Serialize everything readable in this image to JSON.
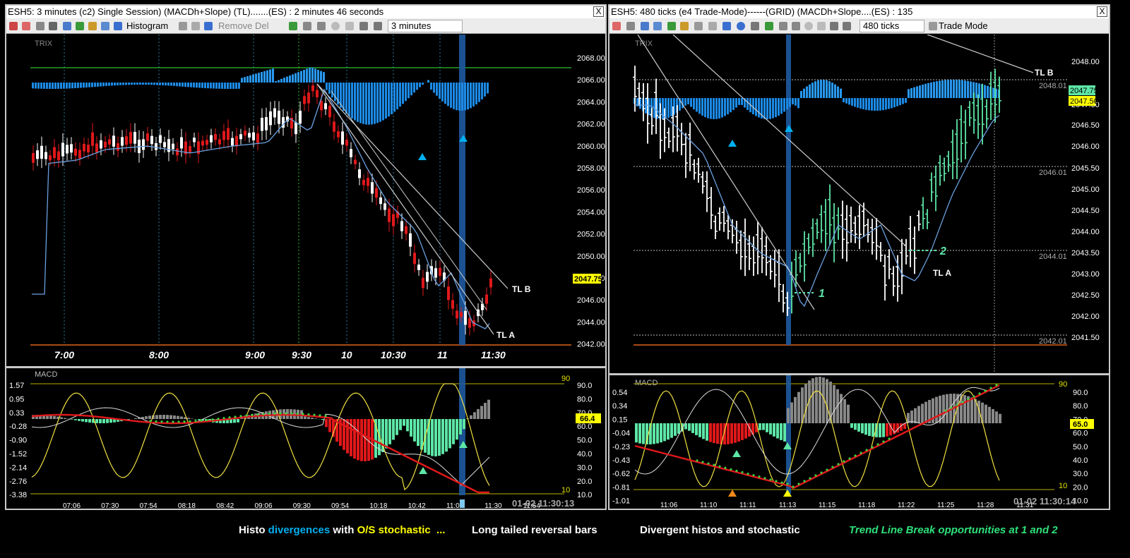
{
  "left_window": {
    "title": "ESH5: 3 minutes (c2)  Single Session) (MACDh+Slope) (TL).......(ES) : 2 minutes 46 seconds",
    "close_glyph": "X",
    "toolbar": {
      "histogram_label": "Histogram",
      "remove_label": "Remove Del",
      "interval": "3 minutes"
    },
    "price_panel": {
      "indicator_label": "TRIX",
      "price_ticks": [
        "2068.00",
        "2066.00",
        "2064.00",
        "2062.00",
        "2060.00",
        "2058.00",
        "2056.00",
        "2054.00",
        "2052.00",
        "2050.00",
        "2048.00",
        "2046.00",
        "2044.00",
        "2042.00"
      ],
      "current_price": "2047.75",
      "time_labels": [
        "7:00",
        "8:00",
        "9:00",
        "9:30",
        "10",
        "10:30",
        "11",
        "11:30"
      ],
      "trendline_labels": [
        "TL B",
        "TL A"
      ]
    },
    "macd_panel": {
      "label": "MACD",
      "macd_ticks": [
        "1.57",
        "0.95",
        "0.33",
        "-0.28",
        "-0.90",
        "-1.52",
        "-2.14",
        "-2.76",
        "-3.38"
      ],
      "stoch_ticks": [
        "90.0",
        "80.0",
        "70.0",
        "60.0",
        "50.0",
        "40.0",
        "30.0",
        "20.0",
        "10.0"
      ],
      "stoch_value": "66.4",
      "upper_band": "90",
      "lower_band": "10",
      "time_labels": [
        "07:06",
        "07:30",
        "07:54",
        "08:18",
        "08:42",
        "09:06",
        "09:30",
        "09:54",
        "10:18",
        "10:42",
        "11:06",
        "11:30",
        "11:54"
      ],
      "timestamp": "01-02 11:30:13"
    }
  },
  "right_window": {
    "title": "ESH5: 480 ticks (e4 Trade-Mode)------(GRID) (MACDh+Slope....(ES) : 135",
    "close_glyph": "X",
    "toolbar": {
      "interval": "480 ticks",
      "mode_label": "Trade Mode"
    },
    "price_panel": {
      "indicator_label": "TRIX",
      "price_ticks": [
        "2048.00",
        "2047.00",
        "2046.50",
        "2046.00",
        "2045.50",
        "2045.00",
        "2044.50",
        "2044.00",
        "2043.50",
        "2043.00",
        "2042.50",
        "2042.00",
        "2041.50"
      ],
      "grid_labels": [
        "2048.01",
        "2046.01",
        "2044.01",
        "2042.01"
      ],
      "current_price": "2047.75",
      "bid_price": "2047.50",
      "trendline_labels": [
        "TL B",
        "TL A"
      ],
      "break_labels": [
        "1",
        "2"
      ]
    },
    "macd_panel": {
      "label": "MACD",
      "macd_ticks": [
        "0.54",
        "0.34",
        "0.15",
        "-0.04",
        "-0.23",
        "-0.43",
        "-0.62",
        "-0.81",
        "-1.01"
      ],
      "stoch_ticks": [
        "90.0",
        "80.0",
        "70.0",
        "60.0",
        "50.0",
        "40.0",
        "30.0",
        "20.0",
        "10.0"
      ],
      "stoch_value": "65.0",
      "upper_band": "90",
      "lower_band": "10",
      "time_labels": [
        "11:06",
        "11:10",
        "11:11",
        "11:13",
        "11:15",
        "11:18",
        "11:22",
        "11:25",
        "11:28",
        "11:31"
      ],
      "timestamp": "01-02 11:30:14"
    }
  },
  "captions": {
    "histo": "Histo",
    "divergences": "divergences",
    "with": "with",
    "os_stochastic": "O/S stochastic",
    "dots": "...",
    "long_tailed": "Long tailed reversal bars",
    "divergent": "Divergent histos and stochastic",
    "trend_line": "Trend Line Break opportunities at 1 and 2"
  },
  "colors": {
    "up_candle": "#ffffff",
    "down_candle": "#e0181a",
    "up_candle_right": "#5de6a6",
    "histogram": "#1c8ae6",
    "highlight_bar": "#1e5aa0",
    "marker": "#00b0f0",
    "grid_green": "#2ec02e",
    "support_orange": "#e2621a",
    "stoch_yellow": "#f0e040",
    "accent_yellow": "#ffff00"
  }
}
